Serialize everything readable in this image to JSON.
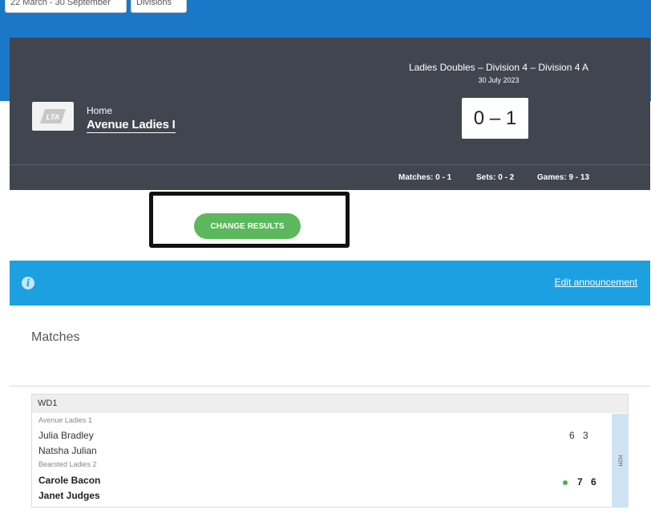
{
  "top_bar": {
    "date_range_label": "22 March - 30 September",
    "filter_label": "Divisions"
  },
  "match": {
    "competition": "Ladies Doubles – Division 4 – Division 4 A",
    "date": "30 July 2023",
    "score": "0 – 1",
    "home_label": "Home",
    "home_team": "Avenue Ladies I",
    "logo_text": "LTA"
  },
  "summary": {
    "matches": "Matches: 0 - 1",
    "sets": "Sets: 0 - 2",
    "games": "Games: 9 - 13"
  },
  "actions": {
    "change_results": "CHANGE RESULTS"
  },
  "announcement": {
    "info_icon": "info-icon",
    "edit_link": "Edit announcement"
  },
  "matches_section": {
    "title": "Matches",
    "rubbers": [
      {
        "code": "WD1",
        "team1": "Avenue Ladies 1",
        "team1_players": [
          "Julia Bradley",
          "Natsha Julian"
        ],
        "team1_scores": [
          "6",
          "3"
        ],
        "team2": "Bearsted Ladies 2",
        "team2_players": [
          "Carole Bacon",
          "Janet Judges"
        ],
        "team2_scores": [
          "7",
          "6"
        ],
        "winner": "team2",
        "h2h_label": "H2H"
      }
    ]
  },
  "colors": {
    "header_blue": "#1b78c8",
    "panel_dark": "#404550",
    "button_green": "#5cb85c",
    "info_blue": "#1ca0e2",
    "win_dot": "#43b649"
  }
}
